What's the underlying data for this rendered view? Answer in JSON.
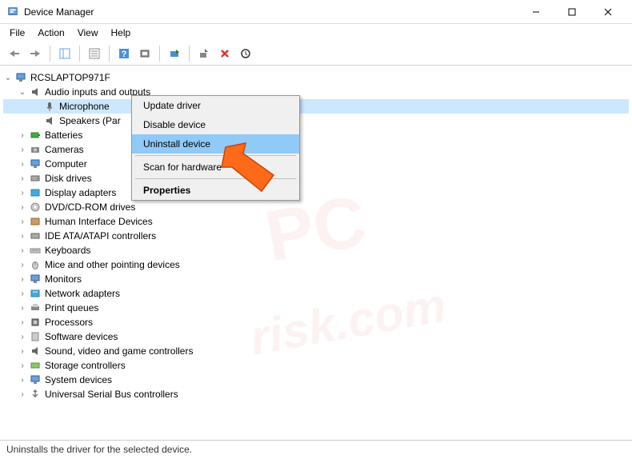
{
  "window": {
    "title": "Device Manager"
  },
  "menubar": {
    "file": "File",
    "action": "Action",
    "view": "View",
    "help": "Help"
  },
  "tree": {
    "root": "RCSLAPTOP971F",
    "audio": "Audio inputs and outputs",
    "microphone": "Microphone",
    "speakers": "Speakers (Par",
    "batteries": "Batteries",
    "cameras": "Cameras",
    "computer": "Computer",
    "diskdrives": "Disk drives",
    "displayadapters": "Display adapters",
    "dvd": "DVD/CD-ROM drives",
    "hid": "Human Interface Devices",
    "ide": "IDE ATA/ATAPI controllers",
    "keyboards": "Keyboards",
    "mice": "Mice and other pointing devices",
    "monitors": "Monitors",
    "network": "Network adapters",
    "printqueues": "Print queues",
    "processors": "Processors",
    "softwaredevices": "Software devices",
    "sound": "Sound, video and game controllers",
    "storage": "Storage controllers",
    "systemdevices": "System devices",
    "usb": "Universal Serial Bus controllers"
  },
  "context_menu": {
    "update": "Update driver",
    "disable": "Disable device",
    "uninstall": "Uninstall device",
    "scan": "Scan for hardware",
    "properties": "Properties"
  },
  "statusbar": {
    "text": "Uninstalls the driver for the selected device."
  },
  "watermark": {
    "line1": "PC",
    "line2": "risk.com"
  }
}
